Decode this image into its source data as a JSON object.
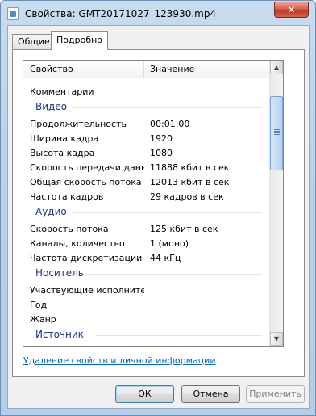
{
  "window": {
    "title": "Свойства: GMT20171027_123930.mp4",
    "close_glyph": "✕",
    "title_icon": "file-video-icon"
  },
  "tabs": [
    {
      "label": "Общие",
      "selected": false
    },
    {
      "label": "Подробно",
      "selected": true
    }
  ],
  "list": {
    "columns": [
      "Свойство",
      "Значение"
    ],
    "top_row": {
      "key": "Комментарии",
      "value": ""
    },
    "groups": [
      {
        "title": "Видео",
        "rows": [
          {
            "key": "Продолжительность",
            "value": "00:01:00"
          },
          {
            "key": "Ширина кадра",
            "value": "1920"
          },
          {
            "key": "Высота кадра",
            "value": "1080"
          },
          {
            "key": "Скорость передачи данн...",
            "value": "11888 кбит в сек"
          },
          {
            "key": "Общая скорость потока",
            "value": "12013 кбит в сек"
          },
          {
            "key": "Частота кадров",
            "value": "29 кадров в сек"
          }
        ]
      },
      {
        "title": "Аудио",
        "rows": [
          {
            "key": "Скорость потока",
            "value": "125 кбит в сек"
          },
          {
            "key": "Каналы, количество",
            "value": "1 (моно)"
          },
          {
            "key": "Частота дискретизации",
            "value": "44 кГц"
          }
        ]
      },
      {
        "title": "Носитель",
        "rows": [
          {
            "key": "Участвующие исполнители",
            "value": ""
          },
          {
            "key": "Год",
            "value": ""
          },
          {
            "key": "Жанр",
            "value": ""
          }
        ]
      },
      {
        "title": "Источник",
        "rows": []
      }
    ],
    "scroll": {
      "up_glyph": "▲",
      "down_glyph": "▼",
      "position_fraction": 0.12
    }
  },
  "remove_link": "Удаление свойств и личной информации",
  "buttons": {
    "ok": "ОК",
    "cancel": "Отмена",
    "apply": "Применить"
  },
  "colors": {
    "group_title": "#1e3287",
    "link": "#0066cc",
    "close_button": "#c0371f"
  }
}
